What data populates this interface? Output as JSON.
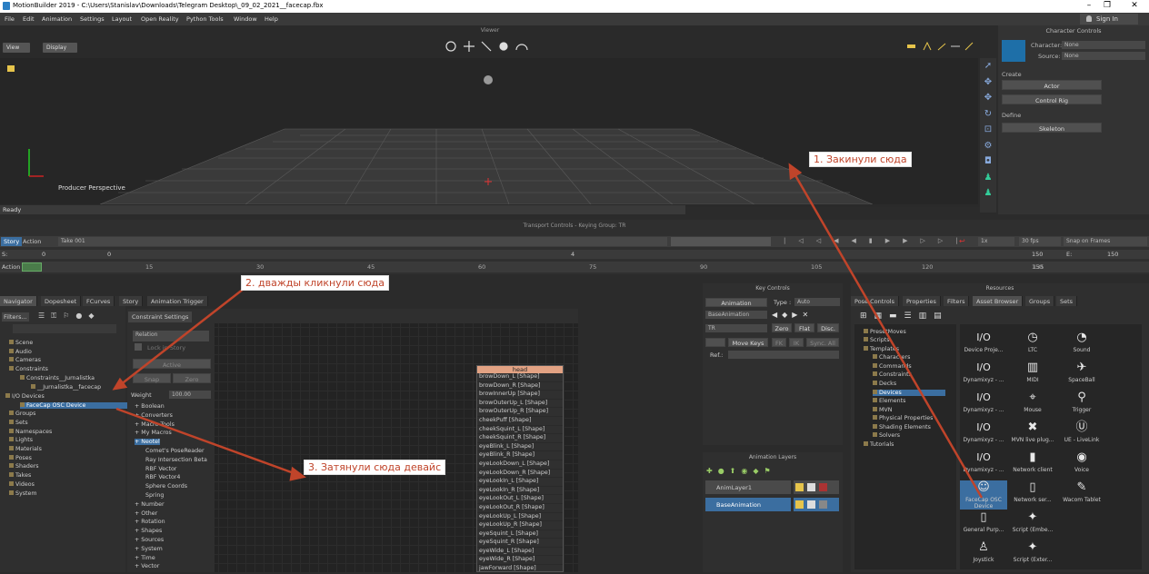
{
  "window": {
    "title": "MotionBuilder 2019  -  C:\\Users\\Stanislav\\Downloads\\Telegram Desktop\\_09_02_2021__facecap.fbx"
  },
  "menu": [
    "File",
    "Edit",
    "Animation",
    "Settings",
    "Layout",
    "Open Reality",
    "Python Tools",
    "Window",
    "Help"
  ],
  "signin": "Sign In",
  "viewer": {
    "header": "Viewer",
    "view_btn": "View",
    "display_btn": "Display",
    "camera": "Producer Perspective",
    "status": "Ready"
  },
  "charctl": {
    "title": "Character Controls",
    "character_label": "Character:",
    "character_value": "None",
    "source_label": "Source:",
    "source_value": "None",
    "create": "Create",
    "actor": "Actor",
    "control_rig": "Control Rig",
    "define": "Define",
    "skeleton": "Skeleton"
  },
  "transport": {
    "header": "Transport Controls  -  Keying Group: TR",
    "story": "Story",
    "action": "Action",
    "take": "Take 001",
    "speed": "1x",
    "fps": "30 fps",
    "snap": "Snap on Frames",
    "s_label": "S:",
    "s_val1": "0",
    "s_val2": "0",
    "val_150a": "150",
    "e_label": "E:",
    "e_val": "150",
    "mid4": "4",
    "action_label": "Action",
    "ticks": [
      "15",
      "30",
      "45",
      "60",
      "75",
      "90",
      "105",
      "120",
      "135"
    ],
    "ruler_end": "150"
  },
  "navigator": {
    "tabs": [
      "Navigator",
      "Dopesheet",
      "FCurves",
      "Story",
      "Animation Trigger"
    ],
    "filters": "Filters...",
    "items": [
      "Scene",
      "Audio",
      "Cameras",
      "Constraints",
      "Constraints__Jurnalistka",
      "__Jurnalistka__facecap",
      "I/O Devices",
      "FaceCap OSC Device",
      "Groups",
      "Sets",
      "Namespaces",
      "Lights",
      "Materials",
      "Poses",
      "Shaders",
      "Takes",
      "Videos",
      "System"
    ]
  },
  "constraint": {
    "tab": "Constraint Settings",
    "relation": "Relation",
    "lock_story": "Lock in Story",
    "active": "Active",
    "snap": "Snap",
    "zero": "Zero",
    "weight_label": "Weight",
    "weight_value": "100.00",
    "items": [
      "Boolean",
      "Converters",
      "Macro Tools",
      "My Macros",
      "Neotel",
      "Comet's PoseReader",
      "Ray Intersection Beta",
      "RBF Vector",
      "RBF Vector4",
      "Sphere Coords",
      "Spring",
      "Number",
      "Other",
      "Rotation",
      "Shapes",
      "Sources",
      "System",
      "Time",
      "Vector"
    ]
  },
  "head_box": {
    "title": "head",
    "shapes": [
      "browDown_L [Shape]",
      "browDown_R [Shape]",
      "browInnerUp [Shape]",
      "browOuterUp_L [Shape]",
      "browOuterUp_R [Shape]",
      "cheekPuff [Shape]",
      "cheekSquint_L [Shape]",
      "cheekSquint_R [Shape]",
      "eyeBlink_L [Shape]",
      "eyeBlink_R [Shape]",
      "eyeLookDown_L [Shape]",
      "eyeLookDown_R [Shape]",
      "eyeLookIn_L [Shape]",
      "eyeLookIn_R [Shape]",
      "eyeLookOut_L [Shape]",
      "eyeLookOut_R [Shape]",
      "eyeLookUp_L [Shape]",
      "eyeLookUp_R [Shape]",
      "eyeSquint_L [Shape]",
      "eyeSquint_R [Shape]",
      "eyeWide_L [Shape]",
      "eyeWide_R [Shape]",
      "jawForward [Shape]"
    ]
  },
  "keyctl": {
    "title": "Key Controls",
    "animation": "Animation",
    "type_label": "Type :",
    "type_value": "Auto",
    "base_anim": "BaseAnimation",
    "tr": "TR",
    "zero": "Zero",
    "flat": "Flat",
    "disc": "Disc.",
    "move_keys": "Move Keys",
    "fk": "FK",
    "ik": "IK",
    "sync": "Sync. All",
    "ref": "Ref.:"
  },
  "animlayers": {
    "title": "Animation Layers",
    "layers": [
      "AnimLayer1",
      "BaseAnimation"
    ]
  },
  "resources": {
    "title": "Resources",
    "tabs": [
      "Pose Controls",
      "Properties",
      "Filters",
      "Asset Browser",
      "Groups",
      "Sets"
    ],
    "tree": [
      "PresetMoves",
      "Scripts",
      "Templates",
      "Characters",
      "Commands",
      "Constraints",
      "Decks",
      "Devices",
      "Elements",
      "MVN",
      "Physical Properties",
      "Shading Elements",
      "Solvers",
      "Tutorials"
    ],
    "assets": [
      {
        "label": "Device Proje...",
        "icon": "I/O"
      },
      {
        "label": "LTC",
        "icon": "◷"
      },
      {
        "label": "Sound",
        "icon": "◔"
      },
      {
        "label": "Dynamixyz - ...",
        "icon": "I/O"
      },
      {
        "label": "MIDI",
        "icon": "▥"
      },
      {
        "label": "SpaceBall",
        "icon": "✈"
      },
      {
        "label": "Dynamixyz - ...",
        "icon": "I/O"
      },
      {
        "label": "Mouse",
        "icon": "⌖"
      },
      {
        "label": "Trigger",
        "icon": "⚲"
      },
      {
        "label": "Dynamixyz - ...",
        "icon": "I/O"
      },
      {
        "label": "MVN live plug...",
        "icon": "✖"
      },
      {
        "label": "UE - LiveLink",
        "icon": "Ⓤ"
      },
      {
        "label": "Dynamixyz - ...",
        "icon": "I/O"
      },
      {
        "label": "Network client",
        "icon": "▮"
      },
      {
        "label": "Voice",
        "icon": "◉"
      },
      {
        "label": "FaceCap OSC Device",
        "icon": "☺"
      },
      {
        "label": "Network ser...",
        "icon": "▯"
      },
      {
        "label": "Wacom Tablet",
        "icon": "✎"
      },
      {
        "label": "General Purp...",
        "icon": "▯"
      },
      {
        "label": "Script (Embe...",
        "icon": "✦"
      },
      {
        "label": "",
        "icon": ""
      },
      {
        "label": "Joystick",
        "icon": "♙"
      },
      {
        "label": "Script (Exter...",
        "icon": "✦"
      },
      {
        "label": "",
        "icon": ""
      }
    ]
  },
  "annotations": {
    "a1": "1. Закинули сюда",
    "a2": "2. дважды кликнули сюда",
    "a3": "3. Затянули сюда девайс"
  }
}
